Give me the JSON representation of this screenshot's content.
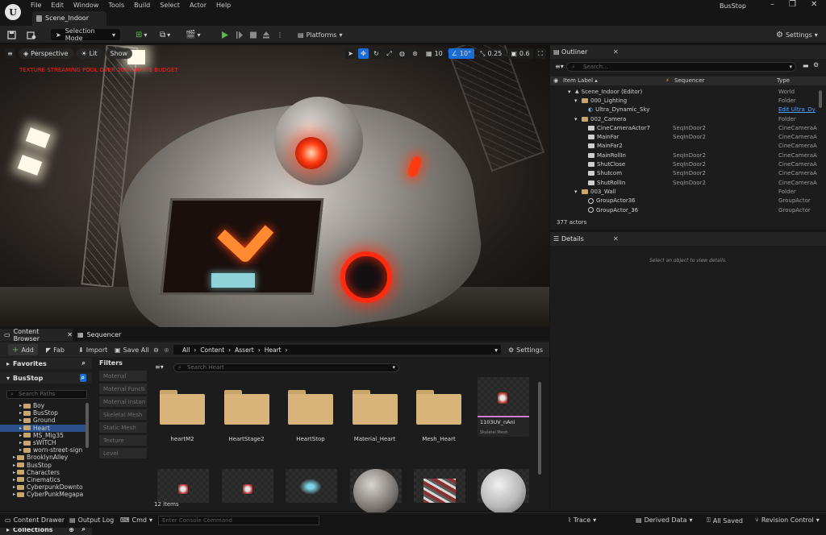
{
  "menu": [
    "File",
    "Edit",
    "Window",
    "Tools",
    "Build",
    "Select",
    "Actor",
    "Help"
  ],
  "document_tab": "Scene_Indoor",
  "project_name": "BusStop",
  "window_controls": [
    "–",
    "❐",
    "✕"
  ],
  "toolbar": {
    "selection_mode": "Selection Mode",
    "platforms": "Platforms",
    "settings": "Settings"
  },
  "viewport": {
    "perspective": "Perspective",
    "lit": "Lit",
    "show": "Show",
    "grid_snap": "10",
    "rotation_snap": "10°",
    "scale_snap": "0.25",
    "camera_speed": "0.6",
    "warning": "TEXTURE STREAMING POOL OVER 2048.34 MiB BUDGET"
  },
  "outliner": {
    "tab": "Outliner",
    "search_placeholder": "Search...",
    "columns": {
      "label": "Item Label ▴",
      "sequencer": "Sequencer",
      "type": "Type"
    },
    "rows": [
      {
        "indent": 0,
        "icon": "level",
        "label": "Scene_Indoor (Editor)",
        "seq": "",
        "type": "World",
        "link": false
      },
      {
        "indent": 1,
        "icon": "folder",
        "label": "000_Lighting",
        "seq": "",
        "type": "Folder",
        "link": false
      },
      {
        "indent": 2,
        "icon": "actor",
        "label": "Ultra_Dynamic_Sky",
        "seq": "",
        "type": "Edit Ultra_Dy",
        "link": true
      },
      {
        "indent": 1,
        "icon": "folder",
        "label": "002_Camera",
        "seq": "",
        "type": "Folder",
        "link": false
      },
      {
        "indent": 2,
        "icon": "camera",
        "label": "CineCameraActor7",
        "seq": "SeqInDoor2",
        "type": "CineCameraA",
        "link": false
      },
      {
        "indent": 2,
        "icon": "camera",
        "label": "MainFar",
        "seq": "SeqInDoor2",
        "type": "CineCameraA",
        "link": false
      },
      {
        "indent": 2,
        "icon": "camera",
        "label": "MainFar2",
        "seq": "",
        "type": "CineCameraA",
        "link": false
      },
      {
        "indent": 2,
        "icon": "camera",
        "label": "MainRollIn",
        "seq": "SeqInDoor2",
        "type": "CineCameraA",
        "link": false
      },
      {
        "indent": 2,
        "icon": "camera",
        "label": "ShutClose",
        "seq": "SeqInDoor2",
        "type": "CineCameraA",
        "link": false
      },
      {
        "indent": 2,
        "icon": "camera",
        "label": "Shutcom",
        "seq": "SeqInDoor2",
        "type": "CineCameraA",
        "link": false
      },
      {
        "indent": 2,
        "icon": "camera",
        "label": "ShutRollIn",
        "seq": "SeqInDoor2",
        "type": "CineCameraA",
        "link": false
      },
      {
        "indent": 1,
        "icon": "folder",
        "label": "003_Wall",
        "seq": "",
        "type": "Folder",
        "link": false
      },
      {
        "indent": 2,
        "icon": "group",
        "label": "GroupActor36",
        "seq": "",
        "type": "GroupActor",
        "link": false
      },
      {
        "indent": 2,
        "icon": "group",
        "label": "GroupActor_36",
        "seq": "",
        "type": "GroupActor",
        "link": false
      }
    ],
    "count": "377 actors"
  },
  "details": {
    "tab": "Details",
    "empty_message": "Select an object to view details."
  },
  "content_browser": {
    "tab": "Content Browser",
    "sequencer_tab": "Sequencer",
    "add": "Add",
    "fab": "Fab",
    "import": "Import",
    "save_all": "Save All",
    "settings": "Settings",
    "breadcrumb": [
      "All",
      "Content",
      "Assert",
      "Heart"
    ],
    "favorites": "Favorites",
    "project": "BusStop",
    "search_paths_placeholder": "Search Paths",
    "tree": [
      {
        "label": "Boy",
        "indent": 1,
        "selected": false
      },
      {
        "label": "BusStop",
        "indent": 1,
        "selected": false
      },
      {
        "label": "Ground",
        "indent": 1,
        "selected": false
      },
      {
        "label": "Heart",
        "indent": 1,
        "selected": true
      },
      {
        "label": "MS_Mig35",
        "indent": 1,
        "selected": false
      },
      {
        "label": "sWITCH",
        "indent": 1,
        "selected": false
      },
      {
        "label": "worn-street-sign",
        "indent": 1,
        "selected": false
      },
      {
        "label": "BrooklynAlley",
        "indent": 0,
        "selected": false
      },
      {
        "label": "BusStop",
        "indent": 0,
        "selected": false
      },
      {
        "label": "Characters",
        "indent": 0,
        "selected": false
      },
      {
        "label": "Cinematics",
        "indent": 0,
        "selected": false
      },
      {
        "label": "CyberpunkDownto",
        "indent": 0,
        "selected": false
      },
      {
        "label": "CyberPunkMegapa",
        "indent": 0,
        "selected": false
      }
    ],
    "collections": "Collections",
    "filters_title": "Filters",
    "filters": [
      "Material",
      "Material Functi",
      "Material Instan",
      "Skeletal Mesh",
      "Static Mesh",
      "Texture",
      "Level"
    ],
    "asset_search_placeholder": "Search Heart",
    "folders": [
      "heartM2",
      "HeartStage2",
      "HeartStop",
      "Material_Heart",
      "Mesh_Heart"
    ],
    "asset_skeletal": {
      "name": "1103UV_nAni",
      "type": "Skeletal Mesh"
    },
    "item_count": "12 items"
  },
  "statusbar": {
    "content_drawer": "Content Drawer",
    "output_log": "Output Log",
    "cmd": "Cmd",
    "console_placeholder": "Enter Console Command",
    "trace": "Trace",
    "derived_data": "Derived Data",
    "all_saved": "All Saved",
    "revision_control": "Revision Control"
  },
  "colors": {
    "accent": "#1b6dd6",
    "warning": "#ff2020",
    "folder": "#d8b47a",
    "link": "#4ea3ff",
    "play": "#57b84d"
  }
}
